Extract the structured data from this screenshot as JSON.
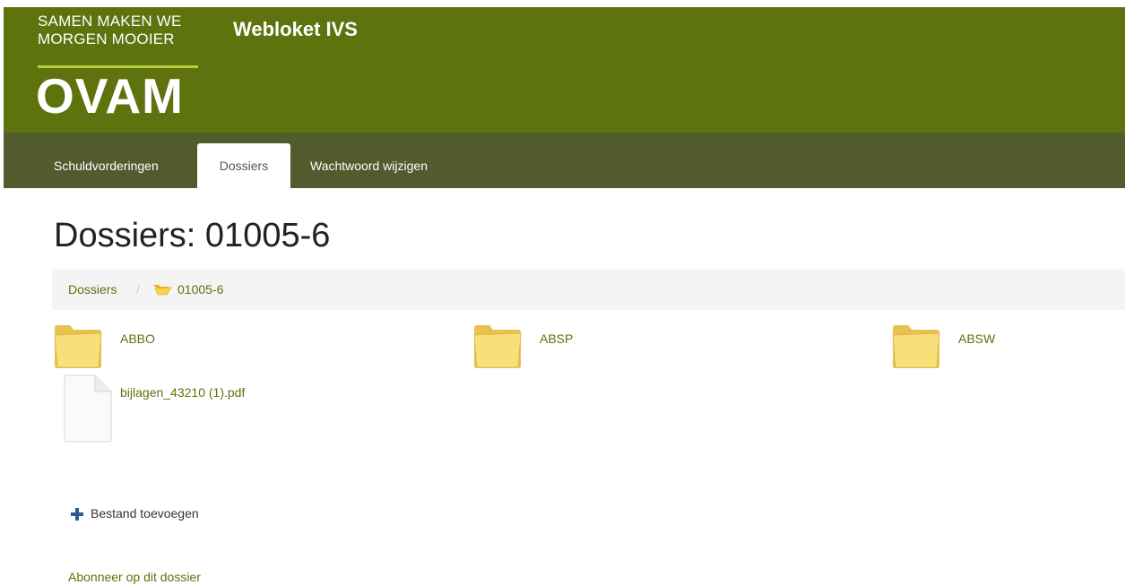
{
  "header": {
    "tagline": [
      "SAMEN MAKEN WE",
      "MORGEN MOOIER"
    ],
    "logo_text": "OVAM",
    "app_title": "Webloket IVS",
    "colors": {
      "header_bg": "#5e720e",
      "nav_bg": "#515b2e",
      "accent": "#b9cc3a"
    }
  },
  "nav": {
    "tabs": [
      {
        "label": "Schuldvorderingen",
        "active": false
      },
      {
        "label": "Dossiers",
        "active": true
      },
      {
        "label": "Wachtwoord wijzigen",
        "active": false
      }
    ]
  },
  "page": {
    "title": "Dossiers: 01005-6"
  },
  "breadcrumb": {
    "items": [
      {
        "label": "Dossiers",
        "icon": ""
      },
      {
        "label": "01005-6",
        "icon": "open-folder-icon"
      }
    ],
    "separator": "/"
  },
  "folders": [
    {
      "label": "ABBO",
      "icon": "folder-icon"
    },
    {
      "label": "ABSP",
      "icon": "folder-icon"
    },
    {
      "label": "ABSW",
      "icon": "folder-icon"
    }
  ],
  "files": [
    {
      "label": "bijlagen_43210 (1).pdf",
      "icon": "document-icon"
    }
  ],
  "actions": {
    "add_file": {
      "label": "Bestand toevoegen",
      "icon": "plus-icon"
    },
    "subscribe": {
      "label": "Abonneer op dit dossier"
    }
  }
}
